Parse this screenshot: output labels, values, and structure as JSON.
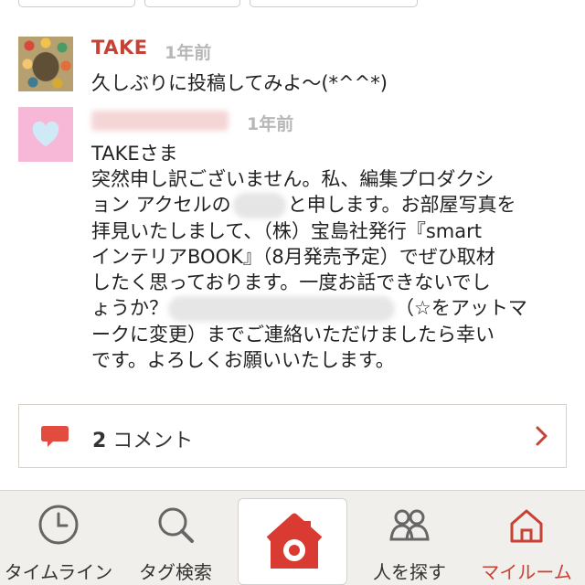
{
  "top_chips": [
    {
      "label": ""
    },
    {
      "label": ""
    },
    {
      "label": ""
    }
  ],
  "comments": [
    {
      "author": "TAKE",
      "time": "1年前",
      "text": "久しぶりに投稿してみよ〜(*^^*)"
    },
    {
      "author": "",
      "time": "1年前",
      "lines": [
        "TAKEさま",
        "突然申し訳ございません。私、編集プロダクシ",
        "ョン アクセルの",
        "と申します。お部屋写真を",
        "拝見いたしまして、（株）宝島社発行『smart",
        "インテリアBOOK』（8月発売予定）でぜひ取材",
        "したく思っております。一度お話できないでし",
        "ょうか？",
        "（☆をアットマ",
        "ークに変更）までご連絡いただけましたら幸い",
        "です。よろしくお願いいたします。"
      ]
    }
  ],
  "comment_summary": {
    "count": "2",
    "label": " コメント"
  },
  "tabbar": [
    {
      "label": "タイムライン",
      "icon": "clock-icon"
    },
    {
      "label": "タグ検索",
      "icon": "search-icon"
    },
    {
      "label": "",
      "icon": "home-camera-icon"
    },
    {
      "label": "人を探す",
      "icon": "people-icon"
    },
    {
      "label": "マイルーム",
      "icon": "house-icon"
    }
  ],
  "colors": {
    "accent": "#c64235",
    "text": "#222222",
    "muted": "#b7b7b7",
    "tabbar_bg": "#f1efeb"
  }
}
